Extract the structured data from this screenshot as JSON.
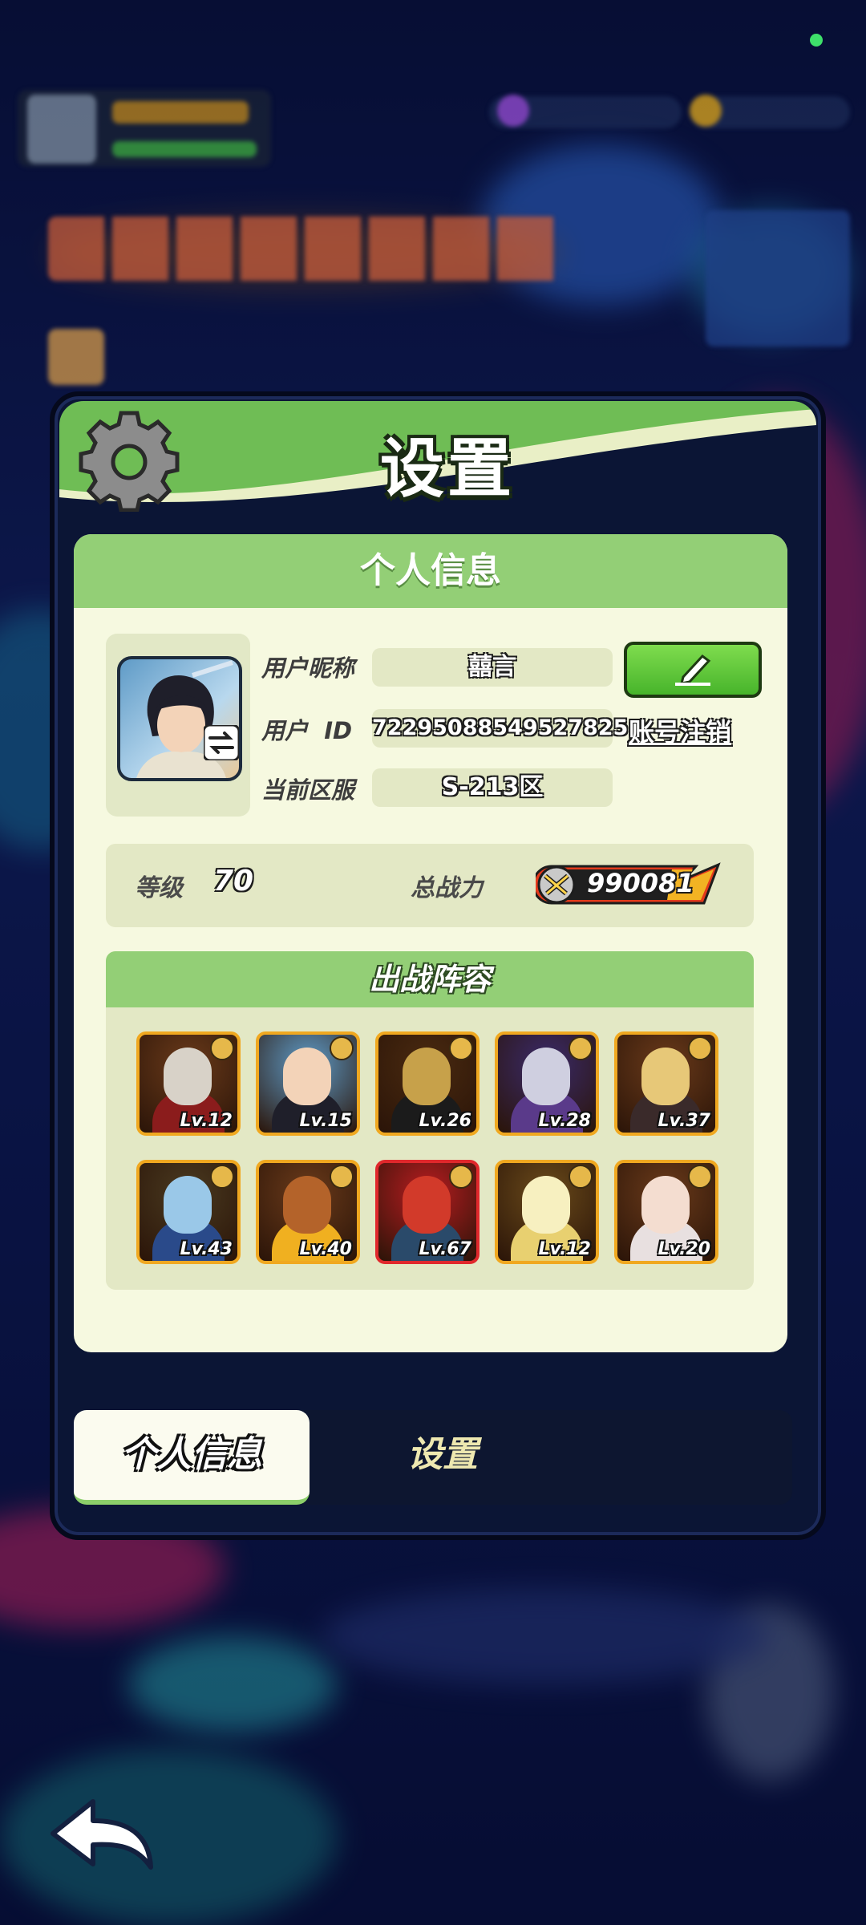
{
  "panel": {
    "title": "设置"
  },
  "profile": {
    "section_title": "个人信息",
    "nickname_label": "用户昵称",
    "nickname_value": "囍言",
    "userid_label": "用户  ID",
    "userid_value": "72295088549527825",
    "server_label": "当前区服",
    "server_value": "S-213区",
    "cancel_account_label": "账号注销"
  },
  "stats": {
    "level_label": "等级",
    "level_value": "70",
    "power_label": "总战力",
    "power_value": "990081"
  },
  "lineup": {
    "title": "出战阵容",
    "heroes": [
      {
        "level": "Lv.12"
      },
      {
        "level": "Lv.15"
      },
      {
        "level": "Lv.26"
      },
      {
        "level": "Lv.28"
      },
      {
        "level": "Lv.37"
      },
      {
        "level": "Lv.43"
      },
      {
        "level": "Lv.40"
      },
      {
        "level": "Lv.67"
      },
      {
        "level": "Lv.12"
      },
      {
        "level": "Lv.20"
      }
    ]
  },
  "tabs": {
    "profile": "个人信息",
    "settings": "设置"
  },
  "colors": {
    "header_green": "#6fbd55",
    "card_bg": "#f6f9e0",
    "accent_green": "#47b42b",
    "hero_frame": "#f0a820",
    "hero_frame_rare": "#e0282c"
  },
  "icons": [
    "gear-icon",
    "swap-icon",
    "edit-pencil-icon",
    "sword-icon",
    "back-arrow-icon"
  ]
}
